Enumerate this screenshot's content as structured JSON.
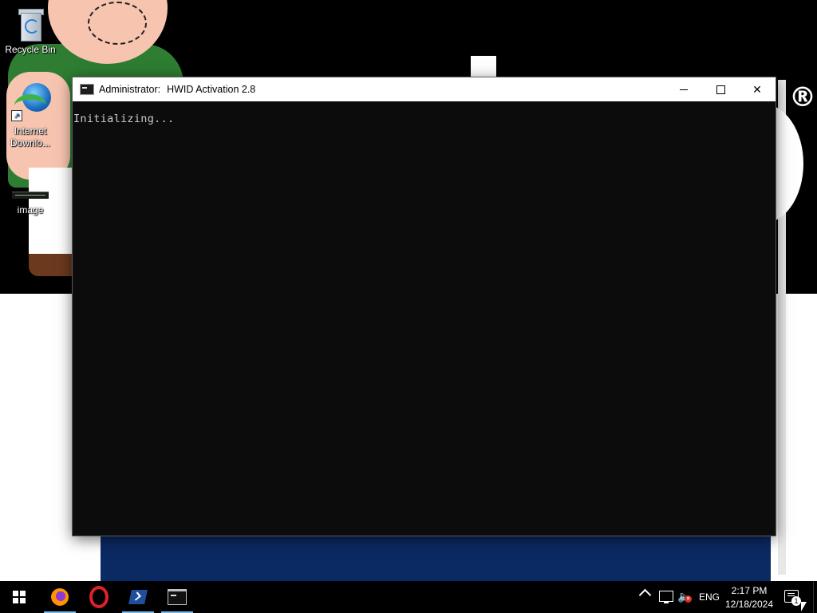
{
  "desktop": {
    "icons": [
      {
        "label": "Recycle Bin",
        "icon": "recycle-bin-icon"
      },
      {
        "label": "Internet Downlo...",
        "icon": "internet-download-manager-icon"
      },
      {
        "label": "image",
        "icon": "image-file-icon"
      }
    ],
    "wallpaper": {
      "registered_mark": "®"
    }
  },
  "window": {
    "title_prefix": "Administrator:",
    "title": "HWID Activation 2.8",
    "buttons": {
      "minimize": "minimize",
      "maximize": "maximize",
      "close": "✕"
    },
    "console_output": "Initializing..."
  },
  "taskbar": {
    "apps": [
      {
        "name": "start",
        "icon": "windows-start-icon"
      },
      {
        "name": "firefox",
        "icon": "firefox-icon",
        "active": true
      },
      {
        "name": "opera",
        "icon": "opera-icon",
        "active": false
      },
      {
        "name": "powershell",
        "icon": "powershell-icon",
        "active": true
      },
      {
        "name": "command-prompt",
        "icon": "cmd-icon",
        "active": true
      }
    ],
    "tray": {
      "language": "ENG",
      "time": "2:17 PM",
      "date": "12/18/2024",
      "notification_count": "1",
      "volume_muted": true
    }
  },
  "colors": {
    "console_bg": "#0c0c0c",
    "console_text": "#cccccc",
    "taskbar_bg": "#000000",
    "active_indicator": "#76b9ed"
  }
}
